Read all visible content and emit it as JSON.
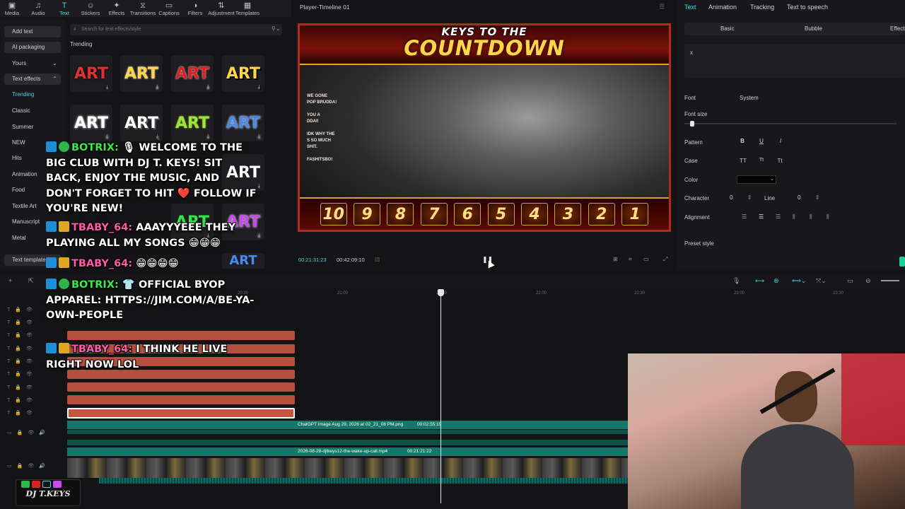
{
  "toolbar": {
    "tools": [
      {
        "label": "Media",
        "icon": "▣",
        "name": "media"
      },
      {
        "label": "Audio",
        "icon": "♫",
        "name": "audio"
      },
      {
        "label": "Text",
        "icon": "T",
        "name": "text"
      },
      {
        "label": "Stickers",
        "icon": "☺",
        "name": "stickers"
      },
      {
        "label": "Effects",
        "icon": "✦",
        "name": "effects"
      },
      {
        "label": "Transitions",
        "icon": "⧖",
        "name": "transitions"
      },
      {
        "label": "Captions",
        "icon": "▭",
        "name": "captions"
      },
      {
        "label": "Filters",
        "icon": "◑",
        "name": "filters"
      },
      {
        "label": "Adjustment",
        "icon": "⇅",
        "name": "adjustment"
      },
      {
        "label": "Templates",
        "icon": "▦",
        "name": "templates"
      }
    ]
  },
  "leftnav": {
    "add_text": "Add text",
    "ai_packaging": "AI packaging",
    "yours": "Yours",
    "text_effects": "Text effects",
    "trending": "Trending",
    "classic": "Classic",
    "summer": "Summer",
    "new": "NEW",
    "hits": "Hits",
    "animation": "Animation",
    "food": "Food",
    "textile_art": "Textile Art",
    "manuscript": "Manuscript",
    "metal": "Metal",
    "text_template": "Text template"
  },
  "library": {
    "search_placeholder": "Search for text effects/style",
    "section": "Trending",
    "tile_text": "ART"
  },
  "player": {
    "title": "Player-Timeline 01",
    "banner_top": "KEYS TO THE",
    "banner_main": "COUNTDOWN",
    "countdown": [
      "10",
      "9",
      "8",
      "7",
      "6",
      "5",
      "4",
      "3",
      "2",
      "1"
    ],
    "mini_chat": [
      "WE GONE",
      "POP BRUDDA!",
      "YOU A",
      "DDAI!",
      "IDK WHY THE",
      "S SO MUCH",
      "SHIT.",
      "FASHITSBO!"
    ],
    "current_time": "00:21:31:23",
    "total_time": "00:42:09:10"
  },
  "inspector": {
    "tabs": [
      "Text",
      "Animation",
      "Tracking",
      "Text to speech"
    ],
    "subtabs": [
      "Basic",
      "Bubble",
      "Effects"
    ],
    "text_value": "x",
    "font_label": "Font",
    "font_value": "System",
    "font_size_label": "Font size",
    "pattern_label": "Pattern",
    "pattern_b": "B",
    "pattern_u": "U",
    "pattern_i": "I",
    "case_label": "Case",
    "case_opts": [
      "TT",
      "Tt",
      "Tt"
    ],
    "color_label": "Color",
    "color_value": "#000000",
    "character_label": "Character",
    "character_value": "0",
    "line_label": "Line",
    "line_value": "0",
    "alignment_label": "Alignment",
    "preset_label": "Preset style"
  },
  "timeline": {
    "ticks": [
      "20:30",
      "21:00",
      "21:30",
      "22:00",
      "22:30",
      "23:00",
      "23:30"
    ],
    "clip1_label": "ChatGPT Image Aug 29, 2026 at 02_21_08 PM.png",
    "clip1_duration": "00:02:55:19",
    "clip2_label": "2026-08-28-djtkeys12-the-wake-up-call.mp4",
    "clip2_duration": "00:21:21:22"
  },
  "chat": [
    {
      "user": "BOTRIX:",
      "user_color": "green",
      "badges": [
        "mod",
        "sub"
      ],
      "text": "🎙 WELCOME TO THE BIG CLUB WITH DJ T. KEYS! SIT BACK, ENJOY THE MUSIC, AND DON'T FORGET TO HIT ❤️ FOLLOW IF YOU'RE NEW!"
    },
    {
      "user": "TBABY_64:",
      "user_color": "pink",
      "badges": [
        "mod",
        "crown"
      ],
      "text": "AAAYYYEEE THEY PLAYING ALL MY SONGS 😁😁😁"
    },
    {
      "user": "TBABY_64:",
      "user_color": "pink",
      "badges": [
        "mod",
        "crown"
      ],
      "text": "😁😁😁😁"
    },
    {
      "user": "BOTRIX:",
      "user_color": "green",
      "badges": [
        "mod",
        "sub"
      ],
      "text": "👕 OFFICIAL BYOP APPAREL: HTTPS://JIM.COM/A/BE-YA-OWN-PEOPLE"
    },
    {
      "user": "TBABY_64:",
      "user_color": "pink",
      "badges": [
        "mod",
        "crown"
      ],
      "text": "I THINK HE LIVE RIGHT NOW LOL"
    }
  ],
  "logo": {
    "text": "DJ T.KEYS"
  },
  "colors": {
    "accent": "#3fd8e8",
    "text_clip": "#b5503f",
    "video_clip": "#14776a"
  }
}
